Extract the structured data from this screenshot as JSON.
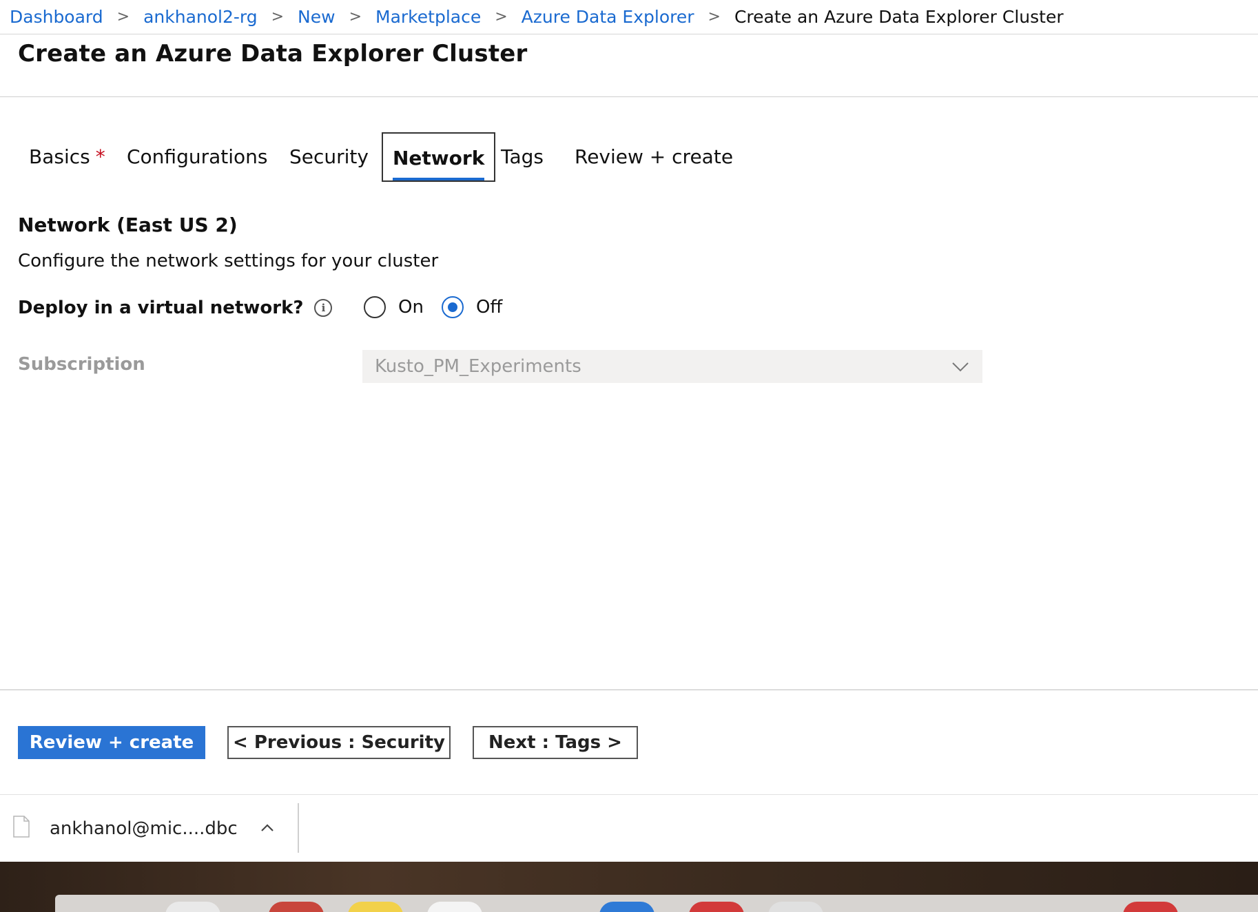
{
  "breadcrumb": {
    "items": [
      "Dashboard",
      "ankhanol2-rg",
      "New",
      "Marketplace",
      "Azure Data Explorer"
    ],
    "current": "Create an Azure Data Explorer Cluster"
  },
  "page": {
    "title": "Create an Azure Data Explorer Cluster"
  },
  "tabs": [
    {
      "label": "Basics",
      "required_marker": "*"
    },
    {
      "label": "Configurations"
    },
    {
      "label": "Security"
    },
    {
      "label": "Network",
      "active": true
    },
    {
      "label": "Tags"
    },
    {
      "label": "Review + create"
    }
  ],
  "network": {
    "heading": "Network (East US 2)",
    "description": "Configure the network settings for your cluster",
    "deploy_label": "Deploy in a virtual network?",
    "info_glyph": "i",
    "options": [
      {
        "label": "On",
        "checked": false
      },
      {
        "label": "Off",
        "checked": true
      }
    ],
    "subscription_label": "Subscription",
    "subscription_value": "Kusto_PM_Experiments"
  },
  "footer": {
    "review_create": "Review + create",
    "previous": "< Previous : Security",
    "next": "Next : Tags >"
  },
  "download": {
    "file_name": "ankhanol@mic....dbc"
  },
  "colors": {
    "accent": "#2a74d4",
    "link": "#1a6ad0",
    "required": "#c50f1f"
  },
  "icons": [
    "chevron-right-icon",
    "info-icon",
    "chevron-down-icon",
    "file-icon",
    "caret-up-icon"
  ]
}
